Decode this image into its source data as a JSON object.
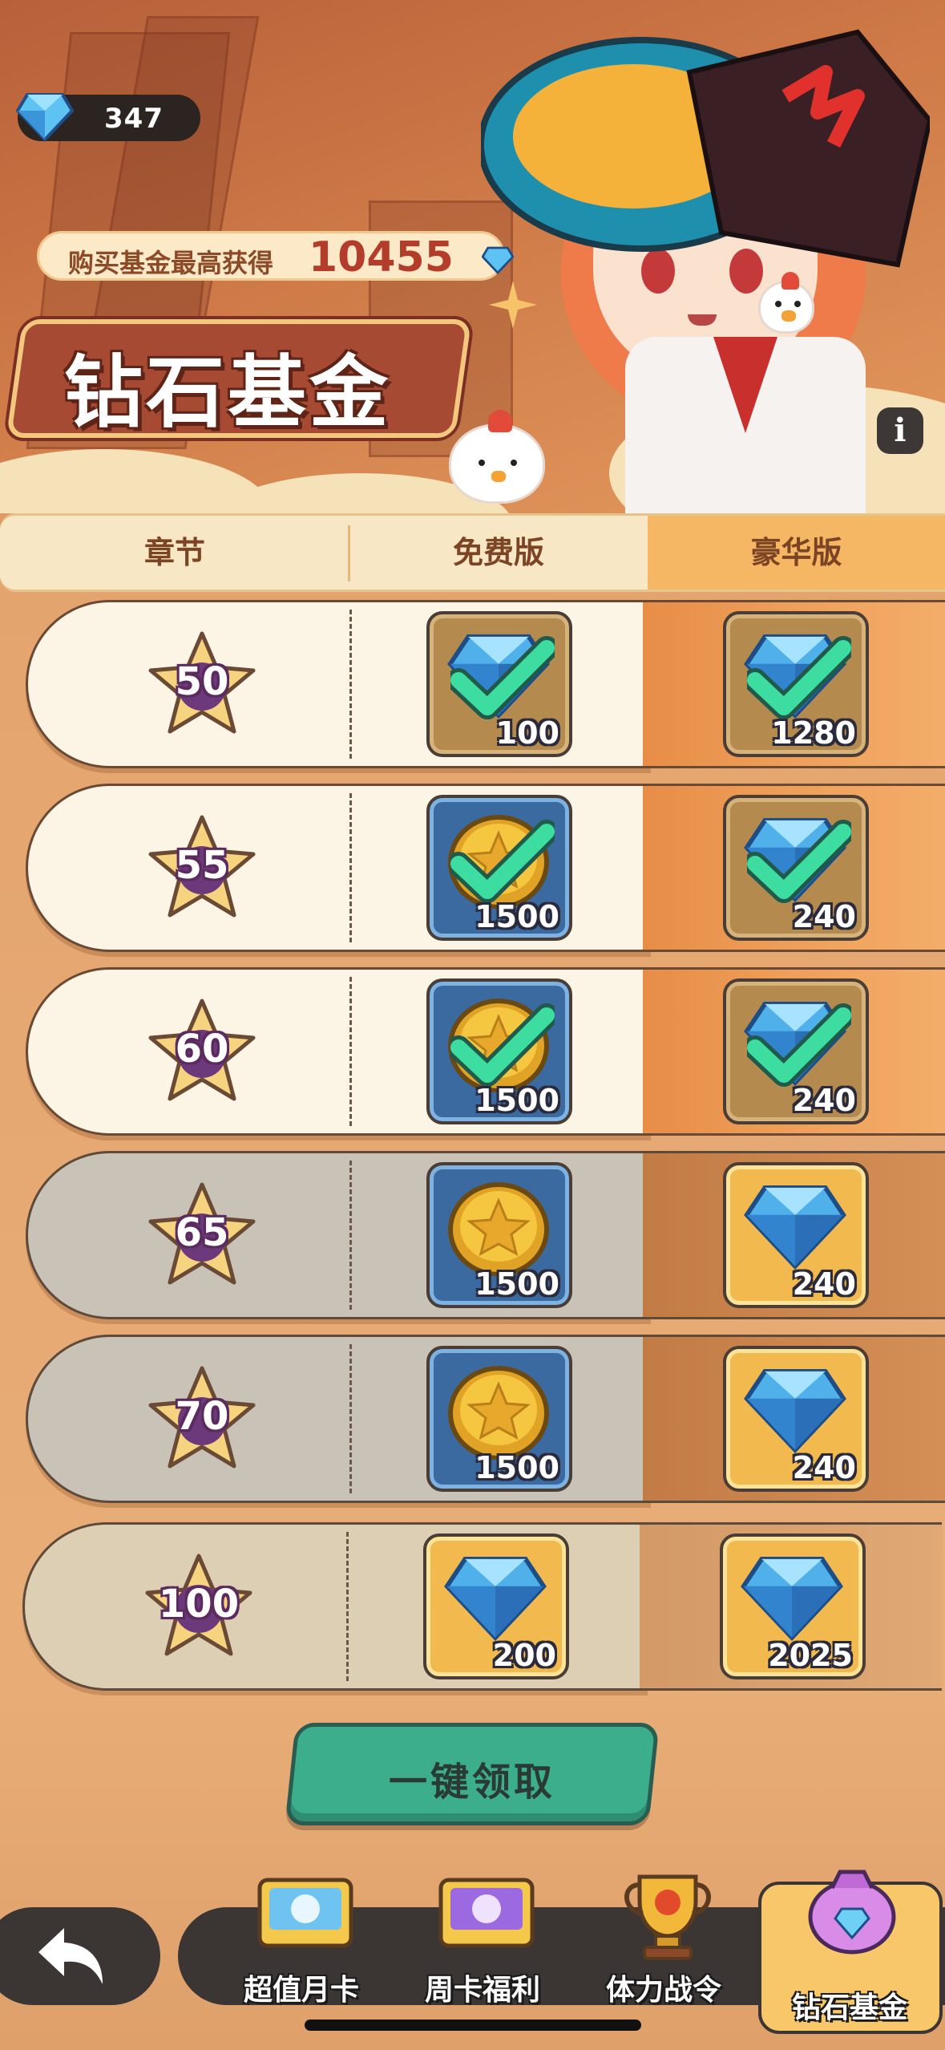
{
  "currency": {
    "icon": "diamond-icon",
    "amount": "347"
  },
  "banner": {
    "label": "购买基金最高获得",
    "max_reward": "10455",
    "title": "钻石基金"
  },
  "columns": {
    "chapter": "章节",
    "free": "免费版",
    "deluxe": "豪华版"
  },
  "rows": [
    {
      "chapter": "50",
      "state": "claimed",
      "free": {
        "icon": "diamond-icon",
        "amount": "100"
      },
      "deluxe": {
        "icon": "diamond-icon",
        "amount": "1280"
      }
    },
    {
      "chapter": "55",
      "state": "claimed",
      "free": {
        "icon": "gold-coin-icon",
        "amount": "1500"
      },
      "deluxe": {
        "icon": "diamond-icon",
        "amount": "240"
      }
    },
    {
      "chapter": "60",
      "state": "claimed",
      "free": {
        "icon": "gold-coin-icon",
        "amount": "1500"
      },
      "deluxe": {
        "icon": "diamond-icon",
        "amount": "240"
      }
    },
    {
      "chapter": "65",
      "state": "locked",
      "free": {
        "icon": "gold-coin-icon",
        "amount": "1500"
      },
      "deluxe": {
        "icon": "diamond-icon",
        "amount": "240"
      }
    },
    {
      "chapter": "70",
      "state": "locked",
      "free": {
        "icon": "gold-coin-icon",
        "amount": "1500"
      },
      "deluxe": {
        "icon": "diamond-icon",
        "amount": "240"
      }
    },
    {
      "chapter": "100",
      "state": "locked",
      "free": {
        "icon": "diamond-icon",
        "amount": "200"
      },
      "deluxe": {
        "icon": "diamond-icon",
        "amount": "2025"
      }
    }
  ],
  "claim_all": "一键领取",
  "nav": [
    {
      "label": "超值月卡",
      "icon": "monthly-card-icon"
    },
    {
      "label": "周卡福利",
      "icon": "weekly-card-icon"
    },
    {
      "label": "体力战令",
      "icon": "trophy-icon"
    },
    {
      "label": "钻石基金",
      "icon": "diamond-bag-icon",
      "active": true
    }
  ],
  "colors": {
    "check": "#3ddca0",
    "claim_button": "#3cae8b",
    "accent": "#f5b763"
  }
}
